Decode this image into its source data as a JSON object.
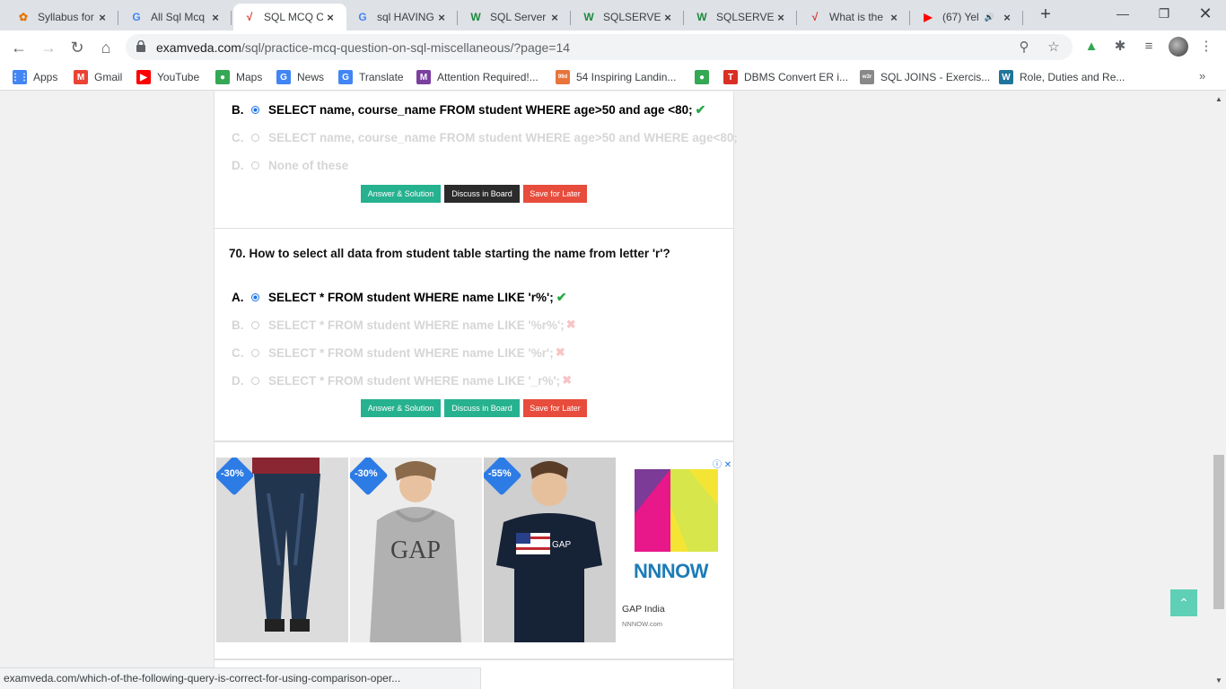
{
  "browser": {
    "tabs": [
      {
        "title": "Syllabus for",
        "icon": "favicon-icon",
        "fav_color": "#e37400",
        "glyph": "✿",
        "active": false,
        "extra": ""
      },
      {
        "title": "All Sql Mcq",
        "icon": "google-icon",
        "fav_color": "#4285f4",
        "glyph": "G",
        "active": false,
        "extra": ""
      },
      {
        "title": "SQL MCQ C",
        "icon": "examveda-icon",
        "fav_color": "#d93025",
        "glyph": "√",
        "active": true,
        "extra": ""
      },
      {
        "title": "sql HAVING",
        "icon": "google-icon",
        "fav_color": "#4285f4",
        "glyph": "G",
        "active": false,
        "extra": ""
      },
      {
        "title": "SQL Server",
        "icon": "w3-icon",
        "fav_color": "#1b8a3c",
        "glyph": "W",
        "active": false,
        "extra": ""
      },
      {
        "title": "SQLSERVER",
        "icon": "w3-icon",
        "fav_color": "#1b8a3c",
        "glyph": "W",
        "active": false,
        "extra": ""
      },
      {
        "title": "SQLSERVER",
        "icon": "w3-icon",
        "fav_color": "#1b8a3c",
        "glyph": "W",
        "active": false,
        "extra": ""
      },
      {
        "title": "What is the",
        "icon": "examveda-icon",
        "fav_color": "#d93025",
        "glyph": "√",
        "active": false,
        "extra": ""
      },
      {
        "title": "(67) Yel",
        "icon": "youtube-icon",
        "fav_color": "#ff0000",
        "glyph": "▶",
        "active": false,
        "extra": "🔊"
      }
    ],
    "url_host": "examveda.com",
    "url_path": "/sql/practice-mcq-question-on-sql-miscellaneous/?page=14",
    "bookmarks": [
      {
        "label": "Apps",
        "icon": "apps-grid-icon",
        "color": "#4285f4",
        "glyph": "⋮⋮"
      },
      {
        "label": "Gmail",
        "icon": "gmail-icon",
        "color": "#ea4335",
        "glyph": "M"
      },
      {
        "label": "YouTube",
        "icon": "youtube-icon",
        "color": "#ff0000",
        "glyph": "▶"
      },
      {
        "label": "Maps",
        "icon": "maps-pin-icon",
        "color": "#34a853",
        "glyph": "●"
      },
      {
        "label": "News",
        "icon": "news-icon",
        "color": "#4285f4",
        "glyph": "G"
      },
      {
        "label": "Translate",
        "icon": "translate-icon",
        "color": "#4285f4",
        "glyph": "G"
      },
      {
        "label": "Attention Required!...",
        "icon": "medium-icon",
        "color": "#7b3fa0",
        "glyph": "M"
      },
      {
        "label": "54 Inspiring Landin...",
        "icon": "99d-icon",
        "color": "#e8743b",
        "glyph": "99d"
      },
      {
        "label": "",
        "icon": "maps-pin-icon",
        "color": "#34a853",
        "glyph": "●"
      },
      {
        "label": "DBMS Convert ER i...",
        "icon": "tutorialspoint-icon",
        "color": "#d93025",
        "glyph": "T"
      },
      {
        "label": "SQL JOINS - Exercis...",
        "icon": "w3resource-icon",
        "color": "#888888",
        "glyph": "w3r"
      },
      {
        "label": "Role, Duties and Re...",
        "icon": "wordpress-icon",
        "color": "#21759b",
        "glyph": "W"
      }
    ]
  },
  "question69": {
    "options": [
      {
        "letter": "B.",
        "text": "SELECT name, course_name FROM student WHERE age>50 and age <80;",
        "state": "correct"
      },
      {
        "letter": "C.",
        "text": "SELECT name, course_name FROM student WHERE age>50 and WHERE age<80;",
        "state": "faded"
      },
      {
        "letter": "D.",
        "text": "None of these",
        "state": "faded"
      }
    ],
    "buttons": {
      "answer": "Answer & Solution",
      "discuss": "Discuss in Board",
      "save": "Save for Later"
    }
  },
  "question70": {
    "text": "70. How to select all data from student table starting the name from letter 'r'?",
    "options": [
      {
        "letter": "A.",
        "text": "SELECT * FROM student WHERE name LIKE 'r%';",
        "state": "correct"
      },
      {
        "letter": "B.",
        "text": "SELECT * FROM student WHERE name LIKE '%r%';",
        "state": "wrong"
      },
      {
        "letter": "C.",
        "text": "SELECT * FROM student WHERE name LIKE '%r';",
        "state": "wrong"
      },
      {
        "letter": "D.",
        "text": "SELECT * FROM student WHERE name LIKE '_r%';",
        "state": "wrong"
      }
    ],
    "buttons": {
      "answer": "Answer & Solution",
      "discuss": "Discuss in Board",
      "save": "Save for Later"
    }
  },
  "ad": {
    "badges": [
      "-30%",
      "-30%",
      "-55%"
    ],
    "product_prints": [
      "",
      "GAP",
      "GAP"
    ],
    "logo_word": "NNNOW",
    "brand": "GAP India",
    "domain": "NNNOW.com"
  },
  "status_url": "examveda.com/which-of-the-following-query-is-correct-for-using-comparison-oper...",
  "colors": {
    "accent_green": "#26b18f",
    "dark_button": "#2b2b2b",
    "red_button": "#e74c3c",
    "correct_radio": "#1a73e8"
  }
}
